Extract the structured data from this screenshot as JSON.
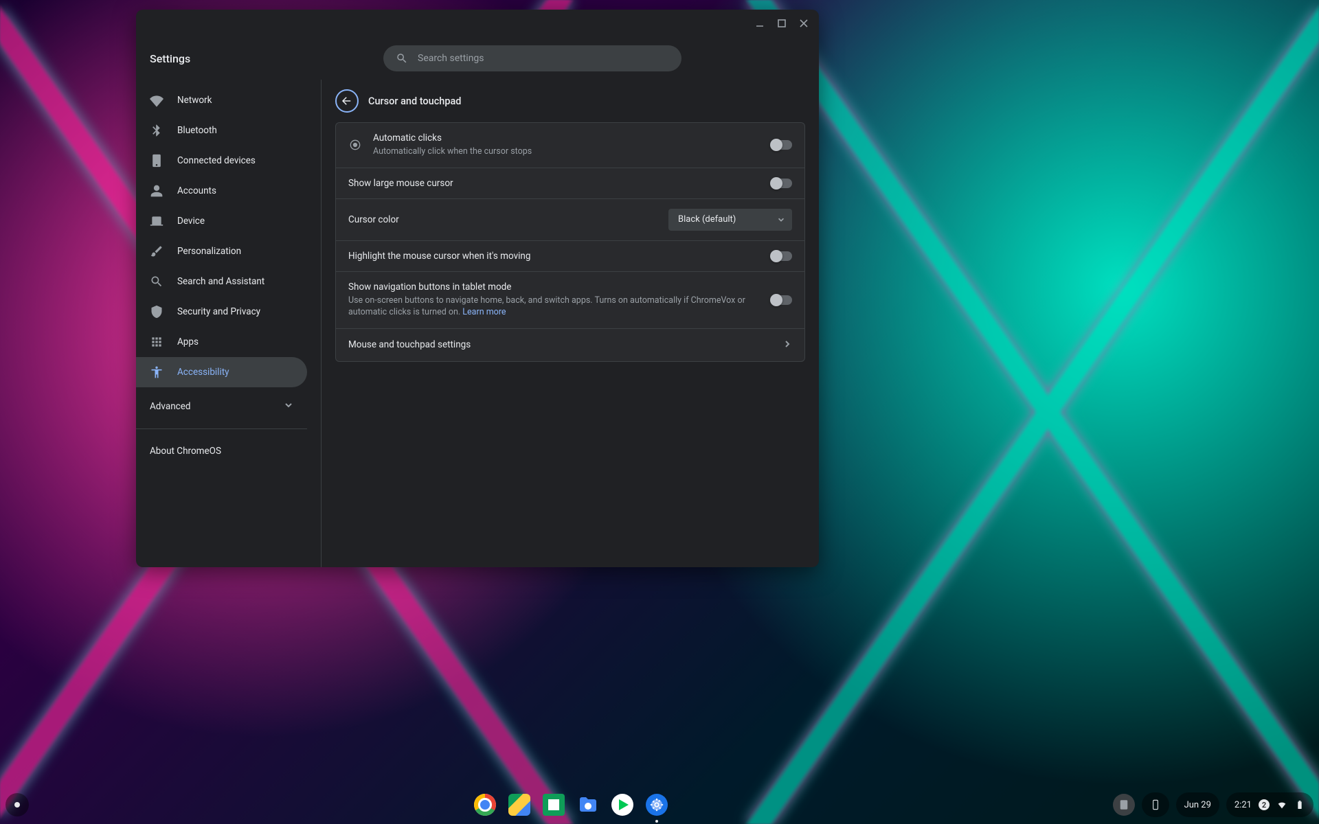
{
  "app_title": "Settings",
  "search": {
    "placeholder": "Search settings"
  },
  "sidebar": {
    "items": [
      {
        "label": "Network"
      },
      {
        "label": "Bluetooth"
      },
      {
        "label": "Connected devices"
      },
      {
        "label": "Accounts"
      },
      {
        "label": "Device"
      },
      {
        "label": "Personalization"
      },
      {
        "label": "Search and Assistant"
      },
      {
        "label": "Security and Privacy"
      },
      {
        "label": "Apps"
      },
      {
        "label": "Accessibility"
      }
    ],
    "advanced": "Advanced",
    "about": "About ChromeOS"
  },
  "page": {
    "title": "Cursor and touchpad",
    "rows": {
      "auto_clicks": {
        "title": "Automatic clicks",
        "sub": "Automatically click when the cursor stops"
      },
      "large_cursor": {
        "title": "Show large mouse cursor"
      },
      "cursor_color": {
        "title": "Cursor color",
        "selected": "Black (default)"
      },
      "highlight": {
        "title": "Highlight the mouse cursor when it's moving"
      },
      "tablet_nav": {
        "title": "Show navigation buttons in tablet mode",
        "sub": "Use on-screen buttons to navigate home, back, and switch apps. Turns on automatically if ChromeVox or automatic clicks is turned on. ",
        "link": "Learn more"
      },
      "mouse_touchpad": {
        "title": "Mouse and touchpad settings"
      }
    }
  },
  "shelf": {
    "date": "Jun 29",
    "time": "2:21",
    "notification_badge": "2"
  }
}
